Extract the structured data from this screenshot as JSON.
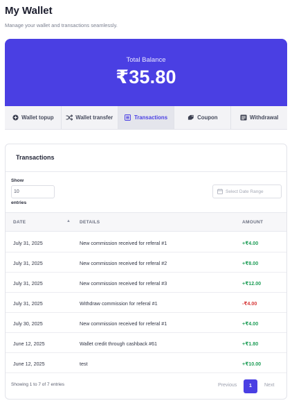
{
  "header": {
    "title": "My Wallet",
    "subtitle": "Manage your wallet and transactions seamlessly."
  },
  "balance": {
    "label": "Total Balance",
    "amount": "₹35.80"
  },
  "tabs": [
    {
      "label": "Wallet topup",
      "icon": "plus-circle-icon",
      "active": false
    },
    {
      "label": "Wallet transfer",
      "icon": "shuffle-icon",
      "active": false
    },
    {
      "label": "Transactions",
      "icon": "list-icon",
      "active": true
    },
    {
      "label": "Coupon",
      "icon": "coupon-icon",
      "active": false
    },
    {
      "label": "Withdrawal",
      "icon": "withdrawal-icon",
      "active": false
    }
  ],
  "panel": {
    "title": "Transactions",
    "show_label": "Show",
    "page_size": "10",
    "entries_label": "entries",
    "date_range_placeholder": "Select Date Range"
  },
  "table": {
    "headers": {
      "date": "DATE",
      "details": "DETAILS",
      "amount": "AMOUNT"
    },
    "rows": [
      {
        "date": "July 31, 2025",
        "details": "New commission received for referal #1",
        "amount": "+₹4.00",
        "sign": "pos"
      },
      {
        "date": "July 31, 2025",
        "details": "New commission received for referal #2",
        "amount": "+₹8.00",
        "sign": "pos"
      },
      {
        "date": "July 31, 2025",
        "details": "New commission received for referal #3",
        "amount": "+₹12.00",
        "sign": "pos"
      },
      {
        "date": "July 31, 2025",
        "details": "Withdraw commission for referal #1",
        "amount": "-₹4.00",
        "sign": "neg"
      },
      {
        "date": "July 30, 2025",
        "details": "New commission received for referal #1",
        "amount": "+₹4.00",
        "sign": "pos"
      },
      {
        "date": "June 12, 2025",
        "details": "Wallet credit through cashback #61",
        "amount": "+₹1.80",
        "sign": "pos"
      },
      {
        "date": "June 12, 2025",
        "details": "test",
        "amount": "+₹10.00",
        "sign": "pos"
      }
    ]
  },
  "footer": {
    "summary": "Showing 1 to 7 of 7 entries",
    "prev_label": "Previous",
    "current_page": "1",
    "next_label": "Next"
  },
  "colors": {
    "accent": "#4a3fe3",
    "positive": "#1f9d57",
    "negative": "#d63a3a"
  }
}
